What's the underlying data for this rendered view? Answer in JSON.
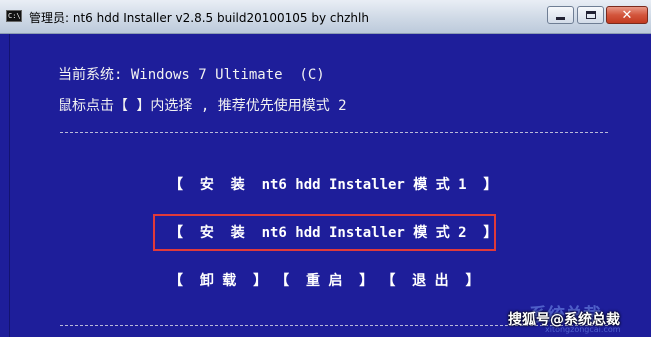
{
  "window": {
    "icon_label": "C:\\",
    "title": "管理员:  nt6 hdd Installer v2.8.5 build20100105 by chzhlh",
    "close_symbol": "✕"
  },
  "console": {
    "system_line": "当前系统: Windows 7 Ultimate  (C)",
    "hint_line": "鼠标点击【 】内选择 , 推荐优先使用模式 2",
    "menu": {
      "mode1": "【  安  装  nt6 hdd Installer 模 式 1  】",
      "mode2": "【  安  装  nt6 hdd Installer 模 式 2  】",
      "uninstall": "【  卸 载  】",
      "restart": "【  重 启  】",
      "exit": "【  退 出  】"
    }
  },
  "watermark": {
    "text": "搜狐号@系统总裁",
    "brand": "系统总裁",
    "url": "xitongzongcai.com"
  },
  "colors": {
    "console_bg": "#1e1e9a",
    "highlight": "#e03a3a"
  }
}
